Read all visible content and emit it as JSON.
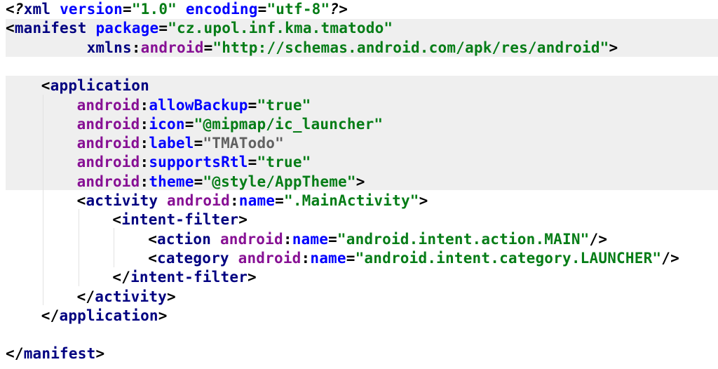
{
  "editor": {
    "file_type": "xml",
    "lines": [
      {
        "id": "xml-declaration",
        "indent": 0,
        "tokens": [
          {
            "text": "<?",
            "cls": "pi"
          },
          {
            "text": "xml",
            "cls": "tag"
          },
          {
            "text": " ",
            "cls": "punct"
          },
          {
            "text": "version",
            "cls": "attr"
          },
          {
            "text": "=",
            "cls": "punct"
          },
          {
            "text": "\"1.0\"",
            "cls": "val"
          },
          {
            "text": " ",
            "cls": "punct"
          },
          {
            "text": "encoding",
            "cls": "attr"
          },
          {
            "text": "=",
            "cls": "punct"
          },
          {
            "text": "\"utf-8\"",
            "cls": "val"
          },
          {
            "text": "?>",
            "cls": "pi"
          }
        ]
      },
      {
        "id": "manifest-open",
        "indent": 0,
        "tokens": [
          {
            "text": "<",
            "cls": "punct"
          },
          {
            "text": "manifest",
            "cls": "tag"
          },
          {
            "text": " ",
            "cls": "punct"
          },
          {
            "text": "package",
            "cls": "attr"
          },
          {
            "text": "=",
            "cls": "punct"
          },
          {
            "text": "\"cz.upol.inf.kma.tmatodo\"",
            "cls": "val"
          }
        ]
      },
      {
        "id": "manifest-xmlns",
        "indent": 0,
        "tokens": [
          {
            "text": "         ",
            "cls": "punct"
          },
          {
            "text": "xmlns",
            "cls": "tag"
          },
          {
            "text": ":",
            "cls": "punct"
          },
          {
            "text": "android",
            "cls": "ns"
          },
          {
            "text": "=",
            "cls": "punct"
          },
          {
            "text": "\"http://schemas.android.com/apk/res/android\"",
            "cls": "val"
          },
          {
            "text": ">",
            "cls": "punct"
          }
        ]
      },
      {
        "id": "blank-1",
        "indent": 0,
        "tokens": []
      },
      {
        "id": "application-open",
        "indent": 4,
        "tokens": [
          {
            "text": "<",
            "cls": "punct"
          },
          {
            "text": "application",
            "cls": "tag"
          }
        ]
      },
      {
        "id": "allow-backup",
        "indent": 8,
        "tokens": [
          {
            "text": "android",
            "cls": "ns"
          },
          {
            "text": ":",
            "cls": "punct"
          },
          {
            "text": "allowBackup",
            "cls": "attr"
          },
          {
            "text": "=",
            "cls": "punct"
          },
          {
            "text": "\"true\"",
            "cls": "val"
          }
        ]
      },
      {
        "id": "icon",
        "indent": 8,
        "tokens": [
          {
            "text": "android",
            "cls": "ns"
          },
          {
            "text": ":",
            "cls": "punct"
          },
          {
            "text": "icon",
            "cls": "attr"
          },
          {
            "text": "=",
            "cls": "punct"
          },
          {
            "text": "\"@mipmap/ic_launcher\"",
            "cls": "val"
          }
        ]
      },
      {
        "id": "label",
        "indent": 8,
        "tokens": [
          {
            "text": "android",
            "cls": "ns"
          },
          {
            "text": ":",
            "cls": "punct"
          },
          {
            "text": "label",
            "cls": "attr"
          },
          {
            "text": "=",
            "cls": "punct"
          },
          {
            "text": "\"TMATodo\"",
            "cls": "gray"
          }
        ]
      },
      {
        "id": "supports-rtl",
        "indent": 8,
        "tokens": [
          {
            "text": "android",
            "cls": "ns"
          },
          {
            "text": ":",
            "cls": "punct"
          },
          {
            "text": "supportsRtl",
            "cls": "attr"
          },
          {
            "text": "=",
            "cls": "punct"
          },
          {
            "text": "\"true\"",
            "cls": "val"
          }
        ]
      },
      {
        "id": "theme",
        "indent": 8,
        "tokens": [
          {
            "text": "android",
            "cls": "ns"
          },
          {
            "text": ":",
            "cls": "punct"
          },
          {
            "text": "theme",
            "cls": "attr"
          },
          {
            "text": "=",
            "cls": "punct"
          },
          {
            "text": "\"@style/AppTheme\"",
            "cls": "val"
          },
          {
            "text": ">",
            "cls": "punct"
          }
        ]
      },
      {
        "id": "activity-open",
        "indent": 8,
        "tokens": [
          {
            "text": "<",
            "cls": "punct"
          },
          {
            "text": "activity",
            "cls": "tag"
          },
          {
            "text": " ",
            "cls": "punct"
          },
          {
            "text": "android",
            "cls": "ns"
          },
          {
            "text": ":",
            "cls": "punct"
          },
          {
            "text": "name",
            "cls": "attr"
          },
          {
            "text": "=",
            "cls": "punct"
          },
          {
            "text": "\".MainActivity\"",
            "cls": "val"
          },
          {
            "text": ">",
            "cls": "punct"
          }
        ]
      },
      {
        "id": "intent-filter-open",
        "indent": 12,
        "tokens": [
          {
            "text": "<",
            "cls": "punct"
          },
          {
            "text": "intent-filter",
            "cls": "tag"
          },
          {
            "text": ">",
            "cls": "punct"
          }
        ]
      },
      {
        "id": "action-main",
        "indent": 16,
        "tokens": [
          {
            "text": "<",
            "cls": "punct"
          },
          {
            "text": "action",
            "cls": "tag"
          },
          {
            "text": " ",
            "cls": "punct"
          },
          {
            "text": "android",
            "cls": "ns"
          },
          {
            "text": ":",
            "cls": "punct"
          },
          {
            "text": "name",
            "cls": "attr"
          },
          {
            "text": "=",
            "cls": "punct"
          },
          {
            "text": "\"android.intent.action.MAIN\"",
            "cls": "val"
          },
          {
            "text": "/>",
            "cls": "punct"
          }
        ]
      },
      {
        "id": "category-launcher",
        "indent": 16,
        "tokens": [
          {
            "text": "<",
            "cls": "punct"
          },
          {
            "text": "category",
            "cls": "tag"
          },
          {
            "text": " ",
            "cls": "punct"
          },
          {
            "text": "android",
            "cls": "ns"
          },
          {
            "text": ":",
            "cls": "punct"
          },
          {
            "text": "name",
            "cls": "attr"
          },
          {
            "text": "=",
            "cls": "punct"
          },
          {
            "text": "\"android.intent.category.LAUNCHER\"",
            "cls": "val"
          },
          {
            "text": "/>",
            "cls": "punct"
          }
        ]
      },
      {
        "id": "intent-filter-close",
        "indent": 12,
        "tokens": [
          {
            "text": "</",
            "cls": "punct"
          },
          {
            "text": "intent-filter",
            "cls": "tag"
          },
          {
            "text": ">",
            "cls": "punct"
          }
        ]
      },
      {
        "id": "activity-close",
        "indent": 8,
        "tokens": [
          {
            "text": "</",
            "cls": "punct"
          },
          {
            "text": "activity",
            "cls": "tag"
          },
          {
            "text": ">",
            "cls": "punct"
          }
        ]
      },
      {
        "id": "application-close",
        "indent": 4,
        "tokens": [
          {
            "text": "</",
            "cls": "punct"
          },
          {
            "text": "application",
            "cls": "tag"
          },
          {
            "text": ">",
            "cls": "punct"
          }
        ]
      },
      {
        "id": "blank-2",
        "indent": 0,
        "tokens": []
      },
      {
        "id": "manifest-close",
        "indent": 0,
        "tokens": [
          {
            "text": "</",
            "cls": "punct"
          },
          {
            "text": "manifest",
            "cls": "tag"
          },
          {
            "text": ">",
            "cls": "punct"
          }
        ]
      }
    ]
  }
}
